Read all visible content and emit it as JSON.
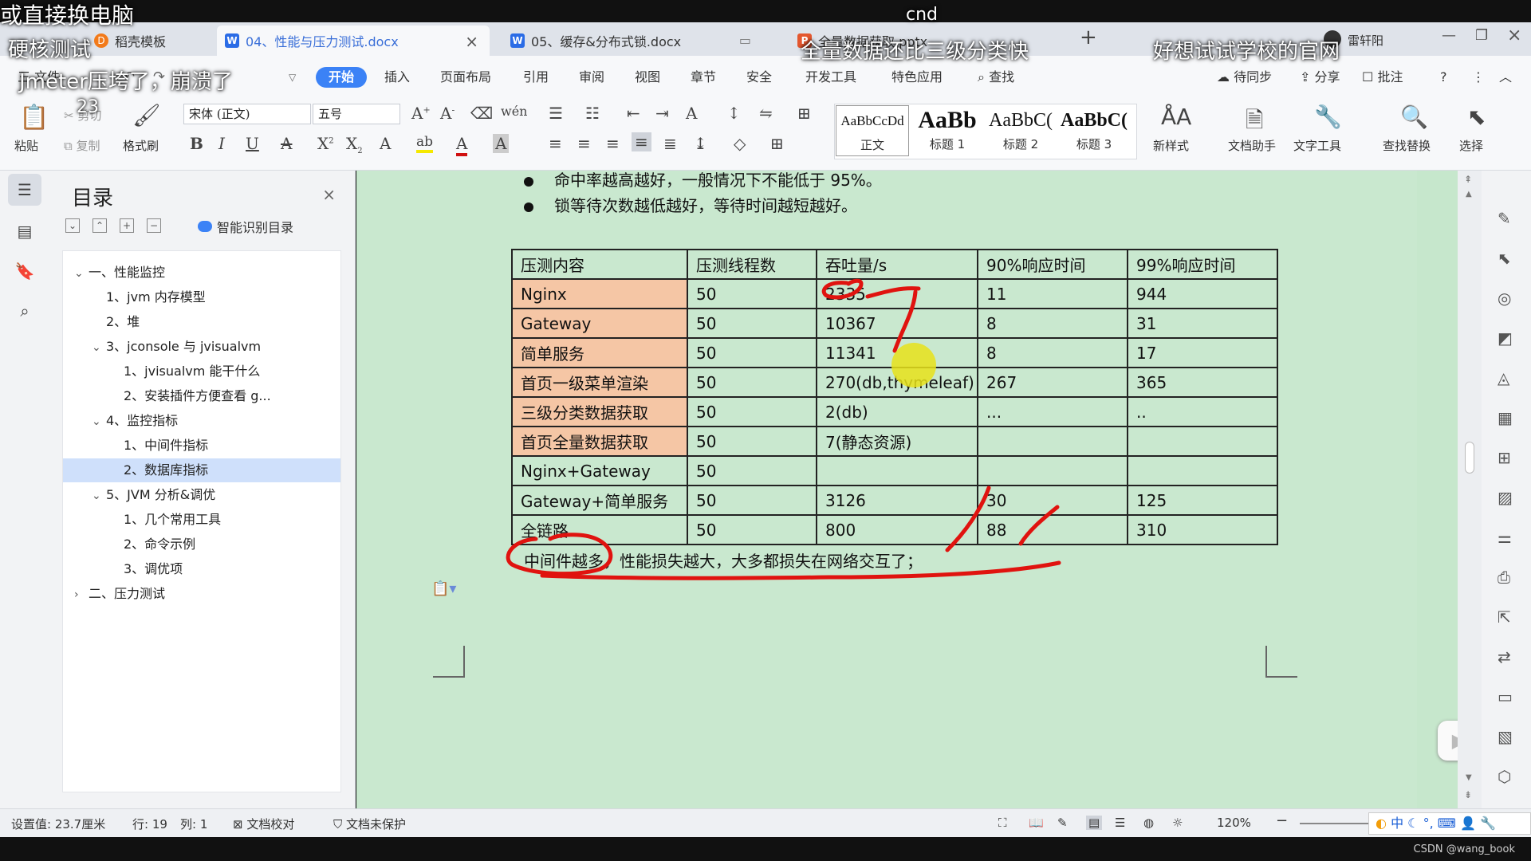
{
  "tabs": [
    {
      "label": "稻壳模板",
      "icon": "docer-icon"
    },
    {
      "label": "04、性能与压力测试.docx",
      "icon": "word-icon",
      "active": true
    },
    {
      "label": "05、缓存&分布式锁.docx",
      "icon": "word-icon"
    },
    {
      "label": "全量数据获取.pptx",
      "icon": "ppt-icon"
    }
  ],
  "user_name": "雷轩阳",
  "menu": {
    "file": "三 文件",
    "items": [
      "开始",
      "插入",
      "页面布局",
      "引用",
      "审阅",
      "视图",
      "章节",
      "安全",
      "开发工具",
      "特色应用"
    ],
    "search": "查找",
    "right": [
      "待同步",
      "分享",
      "批注"
    ]
  },
  "ribbon": {
    "paste": "粘贴",
    "cut": "剪切",
    "copy": "复制",
    "format_painter": "格式刷",
    "font_name": "宋体 (正文)",
    "font_size": "五号",
    "styles": [
      {
        "preview": "AaBbCcDd",
        "label": "正文"
      },
      {
        "preview": "AaBb",
        "label": "标题 1"
      },
      {
        "preview": "AaBbC(",
        "label": "标题 2"
      },
      {
        "preview": "AaBbC(",
        "label": "标题 3"
      }
    ],
    "new_style": "新样式",
    "doc_helper": "文档助手",
    "text_tools": "文字工具",
    "find_replace": "查找替换",
    "select": "选择"
  },
  "outline": {
    "title": "目录",
    "smart": "智能识别目录",
    "items": [
      {
        "text": "一、性能监控",
        "level": 0,
        "chev": "v"
      },
      {
        "text": "1、jvm 内存模型",
        "level": 1
      },
      {
        "text": "2、堆",
        "level": 1
      },
      {
        "text": "3、jconsole 与 jvisualvm",
        "level": 1,
        "chev": "v"
      },
      {
        "text": "1、jvisualvm 能干什么",
        "level": 2
      },
      {
        "text": "2、安装插件方便查看 g...",
        "level": 2
      },
      {
        "text": "4、监控指标",
        "level": 1,
        "chev": "v"
      },
      {
        "text": "1、中间件指标",
        "level": 2
      },
      {
        "text": "2、数据库指标",
        "level": 2,
        "selected": true
      },
      {
        "text": "5、JVM 分析&调优",
        "level": 1,
        "chev": "v"
      },
      {
        "text": "1、几个常用工具",
        "level": 2
      },
      {
        "text": "2、命令示例",
        "level": 2
      },
      {
        "text": "3、调优项",
        "level": 2
      },
      {
        "text": "二、压力测试",
        "level": 0,
        "chev": ">"
      }
    ]
  },
  "document": {
    "bullets": [
      "命中率越高越好，一般情况下不能低于 95%。",
      "锁等待次数越低越好，等待时间越短越好。"
    ],
    "table": {
      "headers": [
        "压测内容",
        "压测线程数",
        "吞吐量/s",
        "90%响应时间",
        "99%响应时间"
      ],
      "rows": [
        {
          "cells": [
            "Nginx",
            "50",
            "2335",
            "11",
            "944"
          ],
          "hl": true
        },
        {
          "cells": [
            "Gateway",
            "50",
            "10367",
            "8",
            "31"
          ],
          "hl": true
        },
        {
          "cells": [
            "简单服务",
            "50",
            "11341",
            "8",
            "17"
          ],
          "hl": true
        },
        {
          "cells": [
            "首页一级菜单渲染",
            "50",
            "270(db,thymeleaf)",
            "267",
            "365"
          ],
          "hl": true
        },
        {
          "cells": [
            "三级分类数据获取",
            "50",
            "2(db)",
            "...",
            ".."
          ],
          "hl": true
        },
        {
          "cells": [
            "首页全量数据获取",
            "50",
            "7(静态资源)",
            "",
            ""
          ],
          "hl": true
        },
        {
          "cells": [
            "Nginx+Gateway",
            "50",
            "",
            "",
            ""
          ],
          "hl": false
        },
        {
          "cells": [
            "Gateway+简单服务",
            "50",
            "3126",
            "30",
            "125"
          ],
          "hl": false
        },
        {
          "cells": [
            "全链路",
            "50",
            "800",
            "88",
            "310"
          ],
          "hl": false
        }
      ]
    },
    "note": "中间件越多，性能损失越大，大多都损失在网络交互了；"
  },
  "status": {
    "setting": "设置值: 23.7厘米",
    "row": "行: 19",
    "col": "列: 1",
    "proof": "文档校对",
    "protect": "文档未保护",
    "zoom": "120%"
  },
  "ime": "中",
  "credit": "CSDN @wang_book",
  "overlays": {
    "o1": "或直接换电脑",
    "o2": "硬核测试",
    "o3": "Jmeter压垮了，崩溃了",
    "o4": "全量数据还比三级分类快",
    "o5": "好想试试学校的官网",
    "o6": "cnd",
    "o7": "23"
  },
  "colors": {
    "accent": "#3b82f6",
    "highlight_cell": "#f5c6a5",
    "doc_background": "#c6e7cc",
    "annotation_red": "#e0130f",
    "cursor_yellow": "#e8e21a"
  }
}
